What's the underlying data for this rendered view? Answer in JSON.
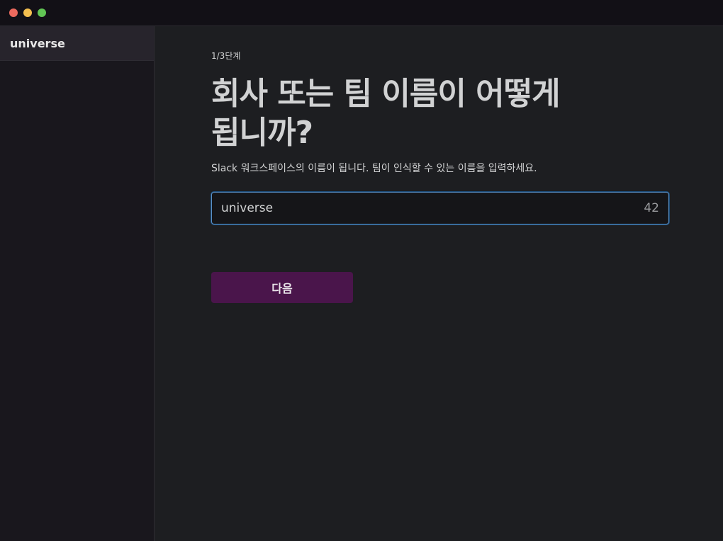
{
  "window": {
    "traffic_lights": [
      "close",
      "minimize",
      "maximize"
    ]
  },
  "sidebar": {
    "workspace_name": "universe"
  },
  "main": {
    "step_label": "1/3단계",
    "title": "회사 또는 팀 이름이 어떻게 됩니까?",
    "subtitle": "Slack 워크스페이스의 이름이 됩니다. 팀이 인식할 수 있는 이름을 입력하세요.",
    "name_input": {
      "value": "universe",
      "remaining_chars": "42"
    },
    "next_button_label": "다음"
  },
  "colors": {
    "accent": "#4a154b",
    "focus_border": "#5a8fc4",
    "background": "#1d1e21",
    "sidebar_background": "#19171d"
  }
}
